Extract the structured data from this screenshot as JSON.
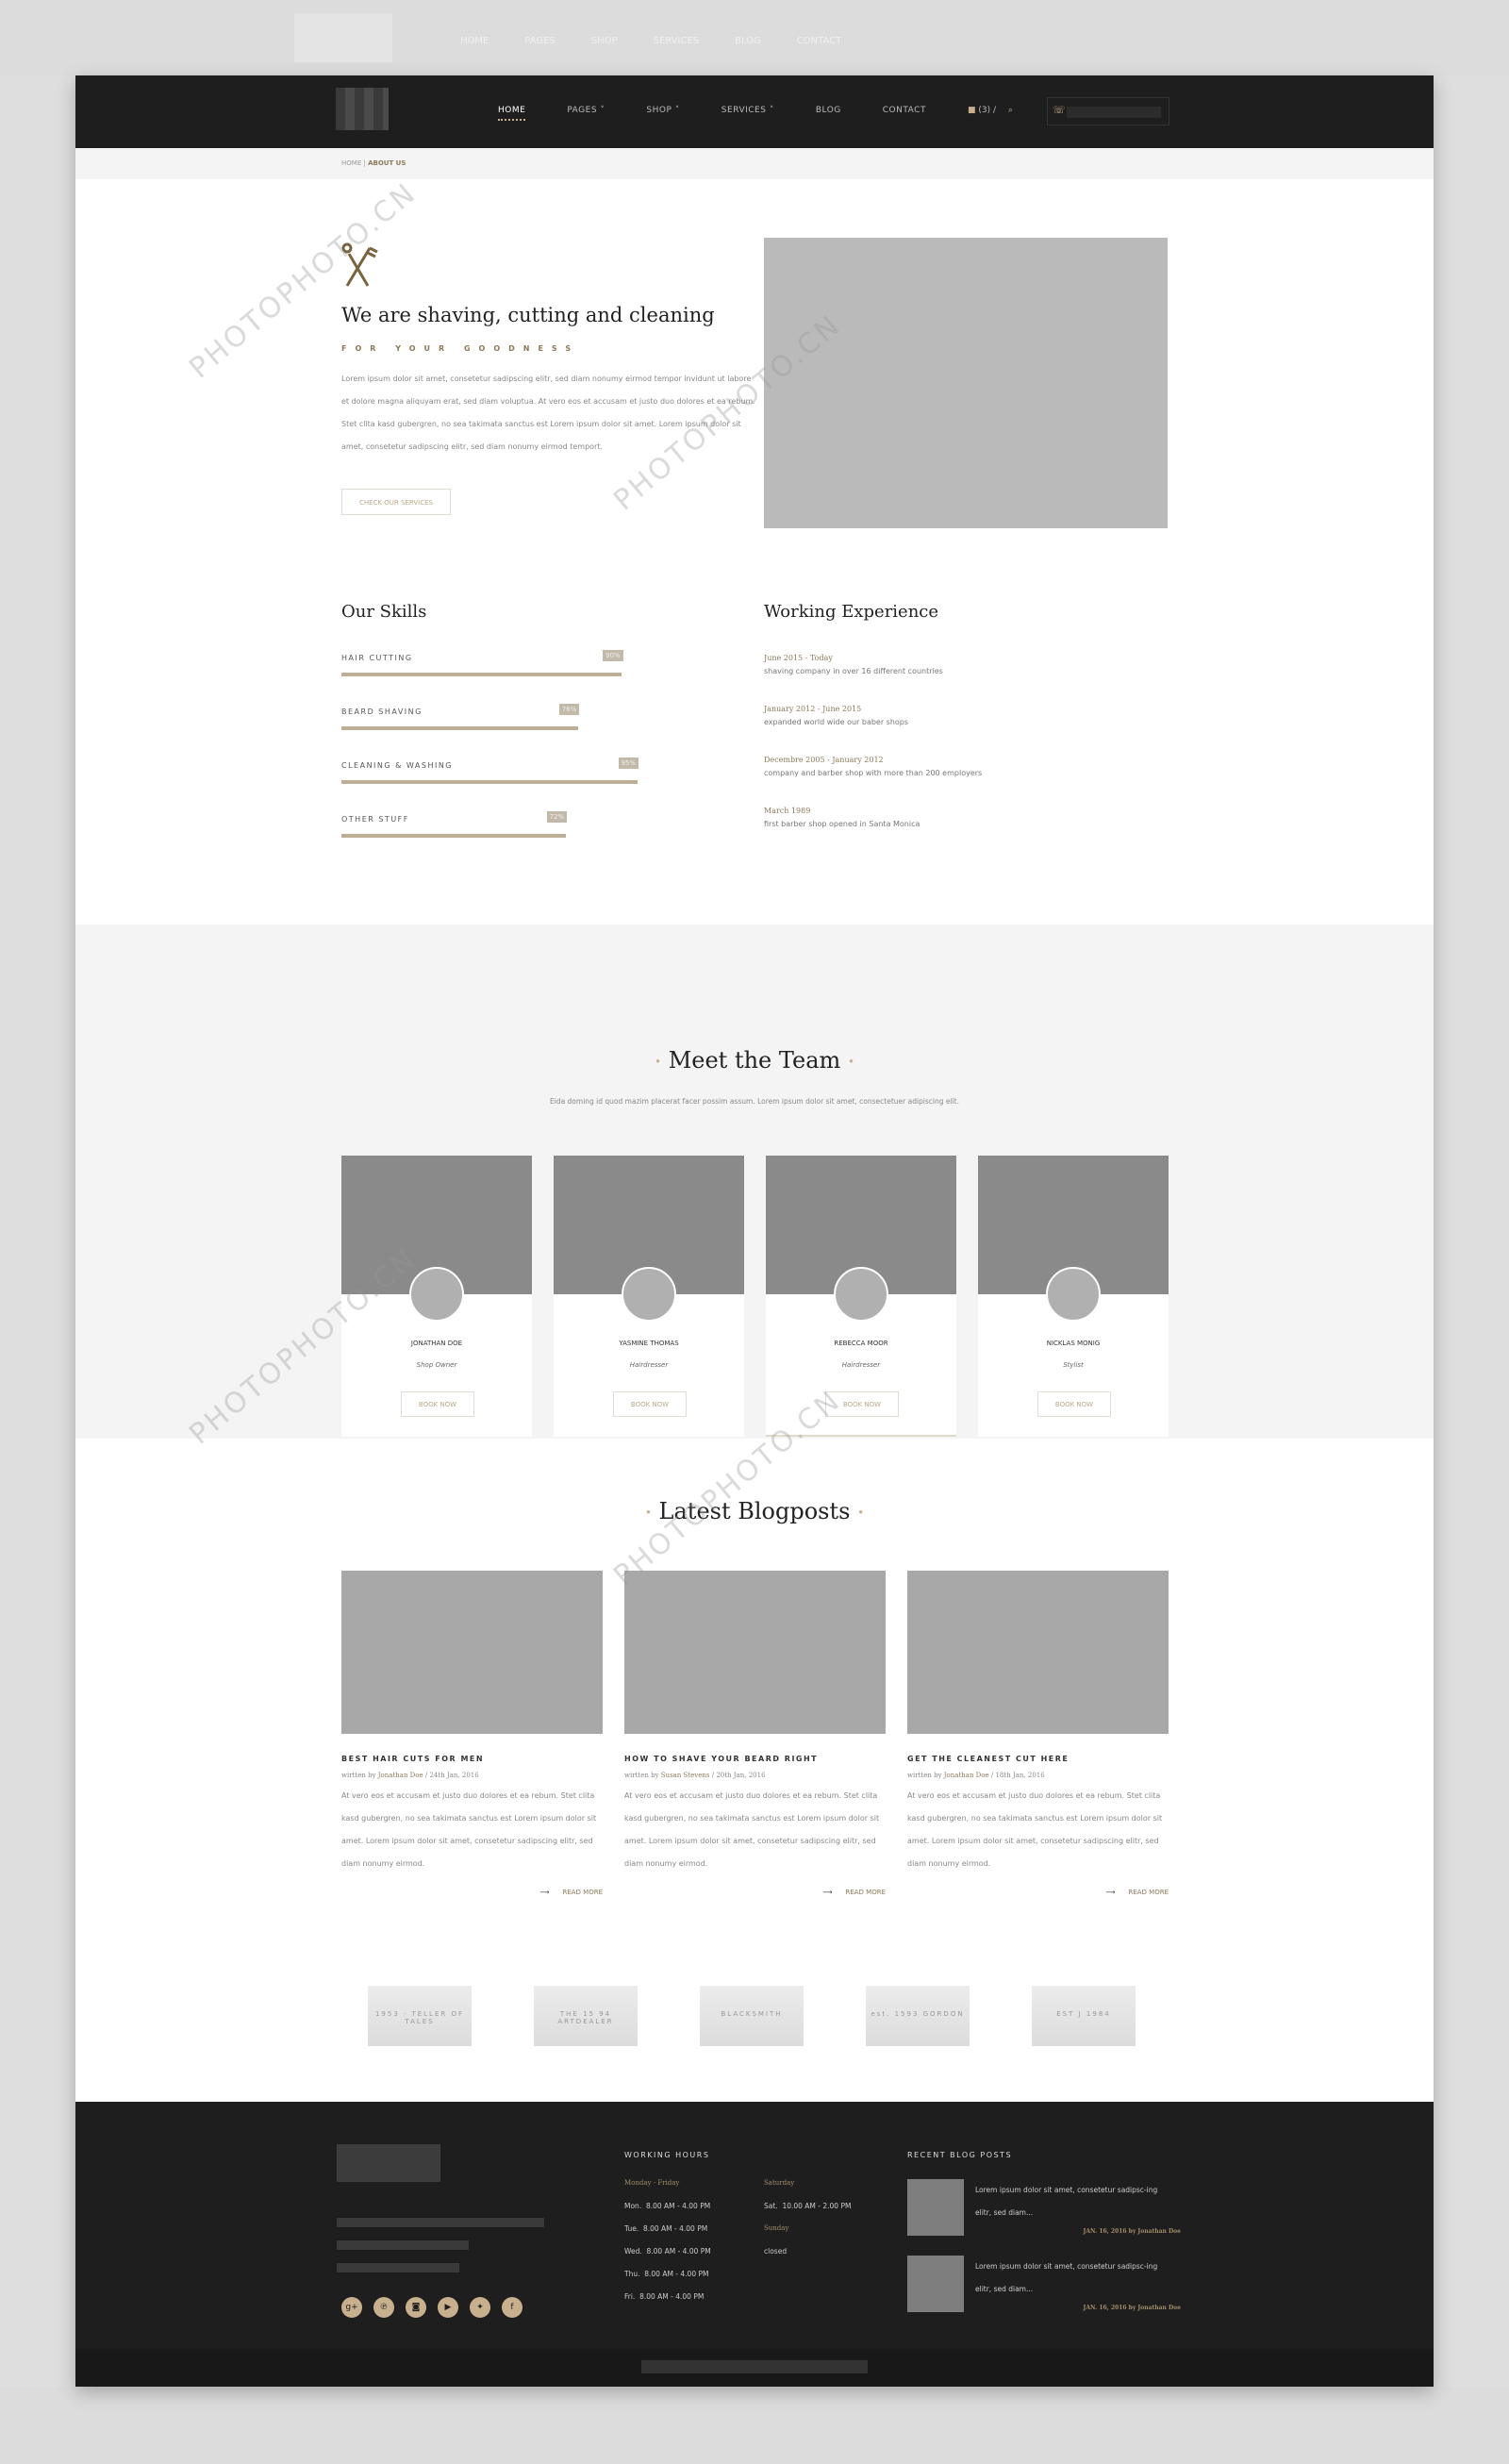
{
  "nav": {
    "items": [
      "HOME",
      "PAGES",
      "SHOP",
      "SERVICES",
      "BLOG",
      "CONTACT"
    ],
    "cart_count": "(3) /",
    "active": "HOME"
  },
  "breadcrumb": {
    "home": "HOME",
    "current": "ABOUT US"
  },
  "intro": {
    "icon": "scissors-comb-icon",
    "heading": "We are shaving, cutting and cleaning",
    "tagline": "FOR YOUR GOODNESS",
    "text": "Lorem ipsum dolor sit amet, consetetur sadipscing elitr, sed diam nonumy eirmod tempor invidunt ut labore et dolore magna aliquyam erat, sed diam voluptua. At vero eos et accusam et justo duo dolores et ea rebum. Stet clita kasd gubergren, no sea takimata sanctus est Lorem ipsum dolor sit amet. Lorem ipsum dolor sit amet, consetetur sadipscing elitr, sed diam nonumy eirmod temport.",
    "button": "CHECK OUR SERVICES"
  },
  "skills": {
    "title": "Our Skills",
    "items": [
      {
        "label": "HAIR CUTTING",
        "pct": "90%",
        "value": 90
      },
      {
        "label": "BEARD SHAVING",
        "pct": "76%",
        "value": 76
      },
      {
        "label": "CLEANING & WASHING",
        "pct": "95%",
        "value": 95
      },
      {
        "label": "OTHER STUFF",
        "pct": "72%",
        "value": 72
      }
    ]
  },
  "experience": {
    "title": "Working Experience",
    "items": [
      {
        "date": "June 2015 - Today",
        "desc": "shaving company in over 16 different countries"
      },
      {
        "date": "January 2012 - June 2015",
        "desc": "expanded world wide our baber shops"
      },
      {
        "date": "Decembre 2005 - January 2012",
        "desc": "company and barber shop with more than 200 employers"
      },
      {
        "date": "March 1989",
        "desc": "first barber shop opened in Santa Monica"
      }
    ]
  },
  "team": {
    "title": "Meet the Team",
    "subtitle": "Eida doming id quod mazim placerat facer possim assum. Lorem ipsum dolor sit amet, consectetuer adipiscing elit.",
    "book": "BOOK NOW",
    "members": [
      {
        "name": "JONATHAN DOE",
        "role": "Shop Owner"
      },
      {
        "name": "YASMINE THOMAS",
        "role": "Hairdresser"
      },
      {
        "name": "REBECCA MOOR",
        "role": "Hairdresser"
      },
      {
        "name": "NICKLAS MONIG",
        "role": "Stylist"
      }
    ]
  },
  "blog": {
    "title": "Latest Blogposts",
    "read_more": "READ MORE",
    "written_by": "wirtten by",
    "posts": [
      {
        "title": "BEST HAIR CUTS FOR MEN",
        "author": "Jonathan Doe",
        "date": "/ 24th Jan, 2016"
      },
      {
        "title": "HOW TO SHAVE YOUR BEARD RIGHT",
        "author": "Susan Stevens",
        "date": "/ 20th Jan, 2016"
      },
      {
        "title": "GET THE CLEANEST CUT HERE",
        "author": "Jonathan Doe",
        "date": "/ 18th Jan, 2016"
      }
    ],
    "excerpt": "At vero eos et accusam et justo duo dolores et ea rebum. Stet clita kasd gubergren, no sea takimata sanctus est Lorem ipsum dolor sit amet. Lorem ipsum dolor sit amet, consetetur sadipscing elitr, sed diam nonumy eirmod."
  },
  "brands": [
    "1953 · TELLER OF TALES",
    "THE 15 94 ARTDEALER",
    "BLACKSMITH",
    "est. 1593 GORDON",
    "EST J 1984"
  ],
  "footer": {
    "hours_title": "WORKING HOURS",
    "weekdays_label": "Monday - Friday",
    "weekdays": [
      "Mon.  8.00 AM - 4.00 PM",
      "Tue.  8.00 AM - 4.00 PM",
      "Wed.  8.00 AM - 4.00 PM",
      "Thu.  8.00 AM - 4.00 PM",
      "Fri.  8.00 AM - 4.00 PM"
    ],
    "saturday_label": "Saturday",
    "saturday": "Sat.  10.00 AM - 2.00 PM",
    "sunday_label": "Sunday",
    "sunday": "closed",
    "posts_title": "RECENT BLOG POSTS",
    "posts": [
      {
        "text": "Lorem ipsum dolor sit amet, consetetur sadipsc-ing elitr, sed diam...",
        "meta": "JAN. 16, 2016 by Jonathan Doe"
      },
      {
        "text": "Lorem ipsum dolor sit amet, consetetur sadipsc-ing elitr, sed diam...",
        "meta": "JAN. 16, 2016 by Jonathan Doe"
      }
    ],
    "social": [
      "google-plus-icon",
      "pinterest-icon",
      "instagram-icon",
      "youtube-icon",
      "twitter-icon",
      "facebook-icon"
    ]
  },
  "watermark": "PHOTOPHOTO.CN",
  "colors": {
    "accent": "#c8b08e",
    "dark": "#1e1e1e",
    "placeholder": "#a8a8a8"
  }
}
